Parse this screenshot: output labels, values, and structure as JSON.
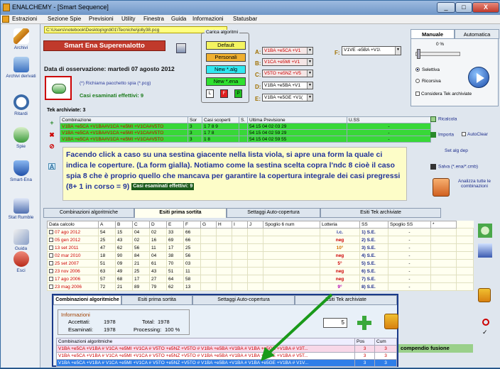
{
  "window": {
    "title": "ENALCHEMY - [Smart Sequence]",
    "min": "_",
    "max": "□",
    "close": "X"
  },
  "menu": [
    "Estrazioni",
    "Sezione Spie",
    "Previsioni",
    "Utility",
    "Finestra",
    "Guida",
    "Informazioni",
    "Statusbar"
  ],
  "sidebar": [
    {
      "label": "Archivi"
    },
    {
      "label": "Archivi derivati"
    },
    {
      "label": "Ritardi"
    },
    {
      "label": "Spie"
    },
    {
      "label": "Smart-Ena"
    },
    {
      "label": "Stat Rumble"
    },
    {
      "label": "Guida"
    },
    {
      "label": "Esci"
    }
  ],
  "path": "C:\\Users\\notebook\\Desktop\\grdi01\\Tecniche\\jolly38.pcg",
  "game_title": "Smart Ena Superenalotto",
  "observation": "Data di osservazione:  martedì 07 agosto 2012",
  "load_link": "(*) Richiama pacchetto spia (*.pcg)",
  "casi_esaminati": "Casi esaminati effettivi: 9",
  "carica": {
    "legend": "Carica algoritmi",
    "default": "Default",
    "personali": "Personali",
    "new_alg": "New *.alg",
    "new_ena": "New *.ena",
    "l": "L",
    "f": "F",
    "p": "P"
  },
  "combos": [
    {
      "label": "A:",
      "value": "V1BA +e5CA +V1"
    },
    {
      "label": "B:",
      "value": "V1CA +e5MI +V1"
    },
    {
      "label": "C:",
      "value": "V5TO +e5NZ +V5"
    },
    {
      "label": "D:",
      "value": "V1BA +e5BA +V1"
    },
    {
      "label": "E:",
      "value": "V1BA +e5GE +V1("
    }
  ],
  "combo_f": {
    "label": "F:",
    "value": "V1VE -e5BA +V1\\"
  },
  "mode": {
    "tab_manual": "Manuale",
    "tab_auto": "Automatica",
    "percent": "0 %",
    "radio_selettiva": "Selettiva",
    "radio_ricorsiva": "Ricorsiva",
    "considera": "Considera Tek archiviate"
  },
  "tek": {
    "header": "Tek archiviate: 3",
    "columns": [
      "Combinazione",
      "Sor",
      "Casi scoperti",
      "S.",
      "Ultima Previsione",
      "U.SS"
    ],
    "rows": [
      {
        "combo": "V1BA +e5CA +V1BA#V1CA +e5MI +V1CA#V5TO",
        "sor": "3",
        "casi": "1 7 8 9",
        "s": "",
        "prev": "54 15 04 02 03 29",
        "uss": "-"
      },
      {
        "combo": "V1BA +e5CA +V1BA#V1CA +e5MI +V1CA#V5TO",
        "sor": "3",
        "casi": "1 7 8",
        "s": "",
        "prev": "54 15 04 02 59 29",
        "uss": "-"
      },
      {
        "combo": "V1BA +e5CA +V1BA#V1CA +e5MI +V1CA#V5TO",
        "sor": "3",
        "casi": "1 8",
        "s": "",
        "prev": "54 15 04 02 59 55",
        "uss": "-"
      }
    ]
  },
  "right_actions": {
    "ricalcola": "Ricalcola",
    "importa": "Importa",
    "autoclear": "AutoClear",
    "set_alg": "Set alg dep",
    "salva": "Salva (*.ena/*.cmb)",
    "analizza": "Analizza tutte le combinazioni"
  },
  "note": "Facendo click a caso su una sestina giacente nella lista viola, si apre una form la quale ci indica le coperture. (La form gialla). Notiamo come la sestina scelta copra l'ndc 8 cioè il caso spia 8 che è proprio quello che mancava per garantire la copertura integrale dei casi pregressi (8+ 1 in corso = 9)",
  "note_chip": "Casi esaminati effettivi: 9",
  "tabs": [
    "Combinazioni algoritmiche",
    "Esiti prima sortita",
    "Settaggi Auto-copertura",
    "Esiti Tek archiviate"
  ],
  "results": {
    "columns": [
      "Data calcolo",
      "A",
      "B",
      "C",
      "D",
      "E",
      "F",
      "G",
      "H",
      "I",
      "J",
      "Spoglio 6 num",
      "Lotteria",
      "SS",
      "Spoglio SS",
      "*"
    ],
    "rows": [
      {
        "date": "07 ago 2012",
        "v": [
          "54",
          "15",
          "04",
          "02",
          "33",
          "66",
          "",
          "",
          "",
          "",
          ""
        ],
        "spoglio": "i.c.",
        "lot": "1) S.E.",
        "ss": "-",
        "cls": "blue"
      },
      {
        "date": "05 gen 2012",
        "v": [
          "25",
          "43",
          "02",
          "16",
          "69",
          "66",
          "",
          "",
          "",
          "",
          ""
        ],
        "spoglio": "neg",
        "lot": "2) S.E.",
        "ss": "-",
        "cls": ""
      },
      {
        "date": "13 set 2011",
        "v": [
          "47",
          "62",
          "56",
          "11",
          "17",
          "25",
          "",
          "",
          "",
          "",
          ""
        ],
        "spoglio": "10°",
        "lot": "3) S.E.",
        "ss": "-",
        "cls": "org"
      },
      {
        "date": "02 mar 2010",
        "v": [
          "18",
          "90",
          "84",
          "04",
          "38",
          "56",
          "",
          "",
          "",
          "",
          ""
        ],
        "spoglio": "neg",
        "lot": "4) S.E.",
        "ss": "-",
        "cls": ""
      },
      {
        "date": "25 set 2007",
        "v": [
          "51",
          "09",
          "21",
          "61",
          "70",
          "03",
          "",
          "",
          "",
          "",
          ""
        ],
        "spoglio": "5°",
        "lot": "5) S.E.",
        "ss": "-",
        "cls": ""
      },
      {
        "date": "23 nov 2006",
        "v": [
          "63",
          "49",
          "25",
          "43",
          "51",
          "11",
          "",
          "",
          "",
          "",
          ""
        ],
        "spoglio": "neg",
        "lot": "6) S.E.",
        "ss": "-",
        "cls": ""
      },
      {
        "date": "17 ago 2006",
        "v": [
          "57",
          "68",
          "17",
          "27",
          "64",
          "58",
          "",
          "",
          "",
          "",
          ""
        ],
        "spoglio": "neg",
        "lot": "7) S.E.",
        "ss": "-",
        "cls": ""
      },
      {
        "date": "23 mag 2006",
        "v": [
          "72",
          "21",
          "89",
          "79",
          "62",
          "13",
          "",
          "",
          "",
          "",
          ""
        ],
        "spoglio": "9°",
        "lot": "8) S.E.",
        "ss": "-",
        "cls": "pur"
      }
    ]
  },
  "overlay": {
    "tabs": [
      "Combinazioni algoritmiche",
      "Esiti prima sortita",
      "Settaggi Auto-copertura",
      "Esiti Tek archiviate"
    ],
    "info_header": "Informazioni",
    "accettati_label": "Accettati:",
    "accettati": "1978",
    "total_label": "Total:",
    "total": "1978",
    "esaminati_label": "Esaminati:",
    "esaminati": "1978",
    "processing_label": "Processing:",
    "processing": "100 %",
    "number": "5",
    "columns": [
      "Combinazioni algoritmiche",
      "Pos",
      "Cum"
    ],
    "rows": [
      {
        "combo": "V1BA +e5CA +V1BA # V1CA +e5MI +V1CA # V5TO +e5NZ +V5TO # V1BA +e5BA +V1BA # V1BA +e5GE +V1BA # V3T...",
        "pos": "3",
        "cum": "3"
      },
      {
        "combo": "V1BA +e5CA +V1BA # V1CA +e5MI +V1CA # V5TO +e5NZ +V5TO # V1BA +e5BA +V1BA # V1BA +e5GE +V1BA # V5T...",
        "pos": "3",
        "cum": "3"
      },
      {
        "combo": "V1BA +e5CA +V1BA # V1CA +e5MI +V1CA # V5TO +e5NZ +V5TO # V1BA +e5BA +V1BA # V1BA +e5GE +V1BA # V1V...",
        "pos": "3",
        "cum": "3"
      }
    ]
  },
  "compendio": "compendio fusione"
}
